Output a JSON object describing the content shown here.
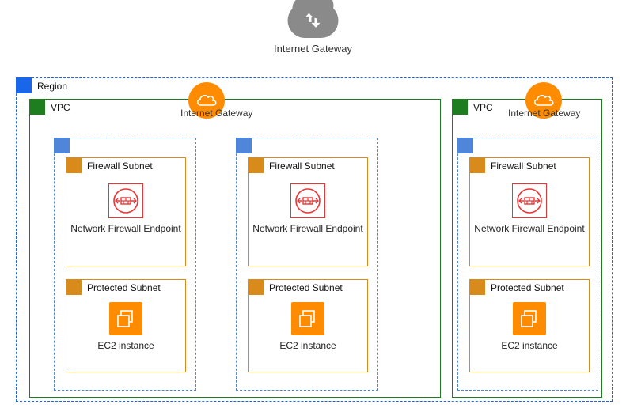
{
  "topGateway": {
    "label": "Internet Gateway"
  },
  "region": {
    "label": "Region"
  },
  "vpcs": [
    {
      "label": "VPC",
      "igwLabel": "Internet Gateway",
      "azs": [
        {
          "firewall": {
            "title": "Firewall Subnet",
            "caption": "Network Firewall Endpoint"
          },
          "protected": {
            "title": "Protected Subnet",
            "caption": "EC2 instance"
          }
        },
        {
          "firewall": {
            "title": "Firewall Subnet",
            "caption": "Network Firewall Endpoint"
          },
          "protected": {
            "title": "Protected Subnet",
            "caption": "EC2 instance"
          }
        }
      ]
    },
    {
      "label": "VPC",
      "igwLabel": "Internet Gateway",
      "azs": [
        {
          "firewall": {
            "title": "Firewall Subnet",
            "caption": "Network Firewall Endpoint"
          },
          "protected": {
            "title": "Protected Subnet",
            "caption": "EC2 instance"
          }
        }
      ]
    }
  ]
}
